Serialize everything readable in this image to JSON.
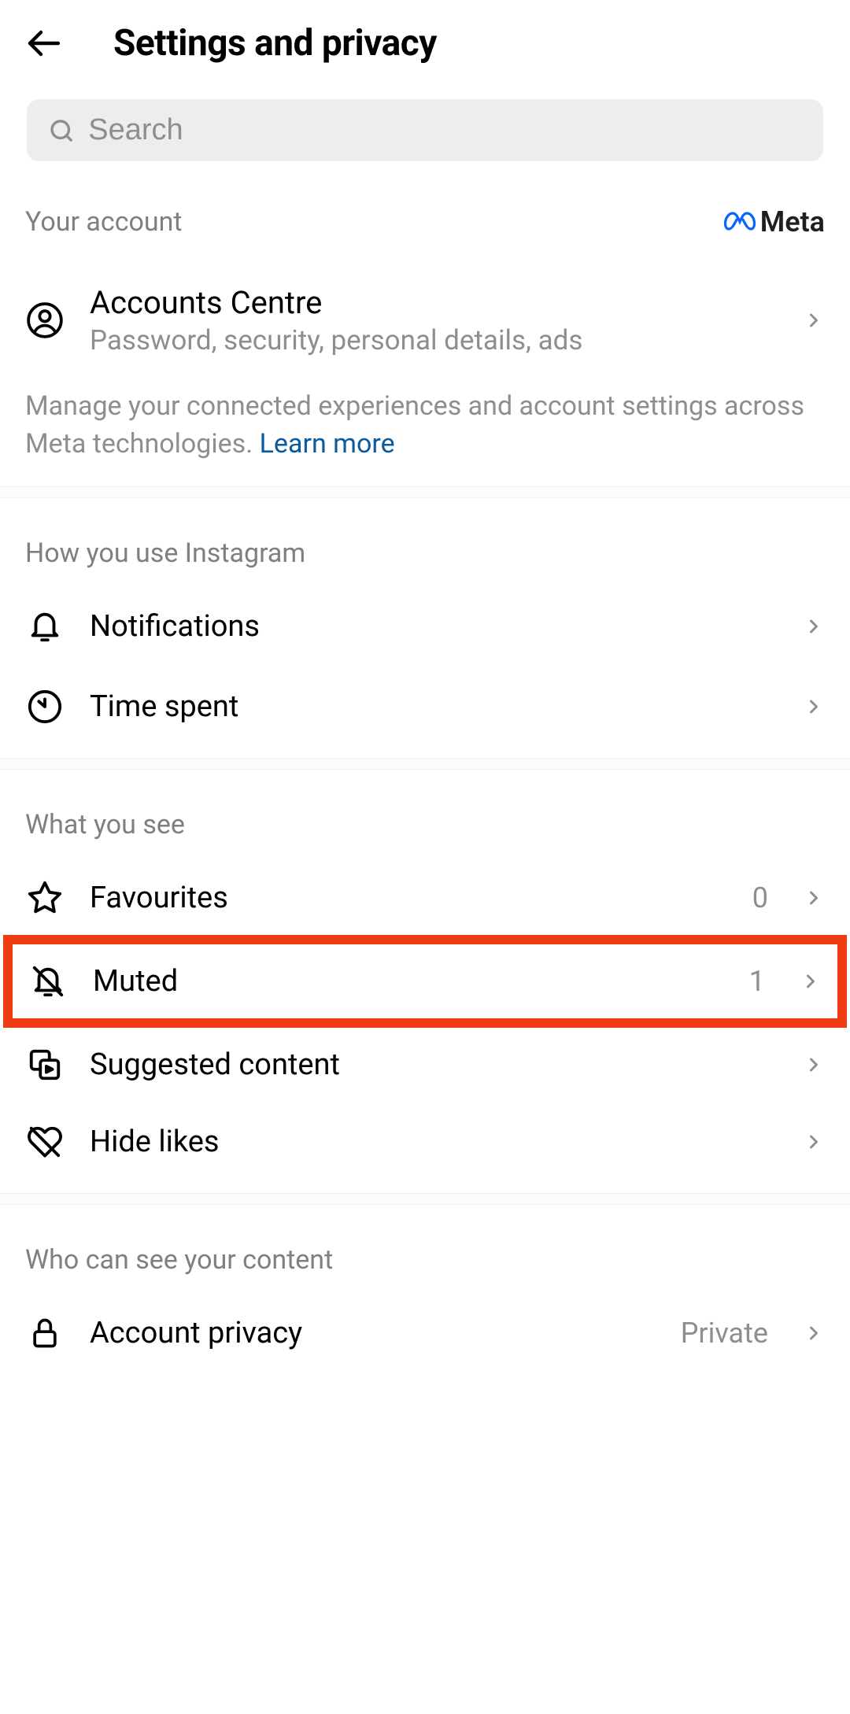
{
  "header": {
    "title": "Settings and privacy"
  },
  "search": {
    "placeholder": "Search"
  },
  "your_account": {
    "section_label": "Your account",
    "brand_label": "Meta",
    "accounts_centre": {
      "title": "Accounts Centre",
      "subtitle": "Password, security, personal details, ads"
    },
    "description": "Manage your connected experiences and account settings across Meta technologies. ",
    "learn_more": "Learn more"
  },
  "how_you_use": {
    "section_label": "How you use Instagram",
    "notifications_label": "Notifications",
    "time_spent_label": "Time spent"
  },
  "what_you_see": {
    "section_label": "What you see",
    "favourites_label": "Favourites",
    "favourites_value": "0",
    "muted_label": "Muted",
    "muted_value": "1",
    "suggested_label": "Suggested content",
    "hide_likes_label": "Hide likes"
  },
  "who_can_see": {
    "section_label": "Who can see your content",
    "account_privacy_label": "Account privacy",
    "account_privacy_value": "Private"
  }
}
